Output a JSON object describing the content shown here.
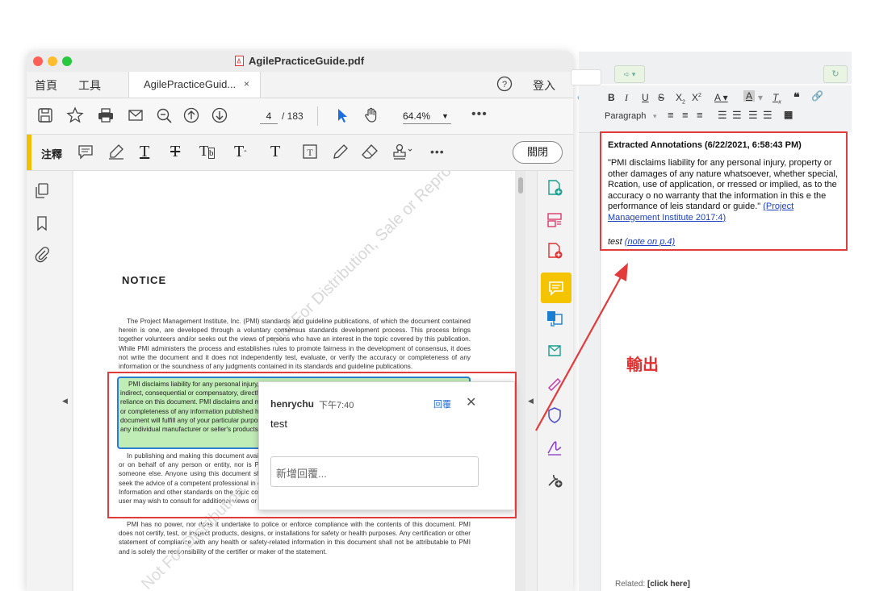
{
  "window": {
    "title": "AgilePracticeGuide.pdf",
    "traffic_lights": {
      "close": "#ff5f57",
      "minimize": "#febc2e",
      "zoom": "#28c840"
    }
  },
  "tabs": {
    "home": "首頁",
    "tools": "工具",
    "document": "AgilePracticeGuid...",
    "close_symbol": "×",
    "signin": "登入",
    "help_icon": "help-icon"
  },
  "toolbar": {
    "page_current": "4",
    "page_total": "/ 183",
    "zoom": "64.4%",
    "icons": [
      "save-icon",
      "bookmark-star-icon",
      "print-icon",
      "mail-icon",
      "zoom-out-icon",
      "page-up-icon",
      "page-down-icon",
      "select-cursor-icon",
      "hand-icon",
      "more-icon"
    ]
  },
  "annotation_toolbar": {
    "label": "注釋",
    "close_label": "關閉",
    "accent": "#f0c000",
    "icons": [
      "sticky-note-icon",
      "highlight-icon",
      "underline-icon",
      "strikethrough-icon",
      "replace-text-icon",
      "insert-text-icon",
      "text-icon",
      "textbox-icon",
      "pencil-icon",
      "eraser-icon",
      "stamp-icon",
      "more-icon"
    ]
  },
  "document": {
    "heading": "NOTICE",
    "paragraphs": [
      "The Project Management Institute, Inc. (PMI) standards and guideline publications, of which the document contained herein is one, are developed through a voluntary consensus standards development process. This process brings together volunteers and/or seeks out the views of persons who have an interest in the topic covered by this publication. While PMI administers the process and establishes rules to promote fairness in the development of consensus, it does not write the document and it does not independently test, evaluate, or verify the accuracy or completeness of any information or the soundness of any judgments contained in its standards and guideline publications.",
      "In publishing and making this document available, PMI is not undertaking to render professional or other services for or on behalf of any person or entity, nor is PMI undertaking to perform any duty owed by any person or entity to someone else. Anyone using this document should rely on his or her own independent judgment or, as appropriate, seek the advice of a competent professional in determining the exercise of reasonable care in any given circumstances. Information and other standards on the topic covered by this publication may be available from other sources, which the user may wish to consult for additional views or information not covered by this publication.",
      "PMI has no power, nor does it undertake to police or enforce compliance with the contents of this document. PMI does not certify, test, or inspect products, designs, or installations for safety or health purposes. Any certification or other statement of compliance with any health or safety-related information in this document shall not be attributable to PMI and is solely the responsibility of the certifier or maker of the statement."
    ],
    "highlighted": "PMI disclaims liability for any personal injury, property or other damages of any nature whatsoever, whether special, indirect, consequential or compensatory, directly or indirectly resulting from the publication, use of application, or reliance on this document. PMI disclaims and makes no guaranty or warranty, expressed or implied, as to the accuracy or completeness of any information published herein, and disclaims and makes no warranty that the information in this document will fulfill any of your particular purposes or needs. PMI does not undertake to guarantee the performance of any individual manufacturer or seller's products or services by virtue of this standard or guide.",
    "watermark": "Not For Distribution, Sale or Reproduction.",
    "watermark2": "Not For Distribution"
  },
  "comment": {
    "user": "henrychu",
    "time": "下午7:40",
    "reply": "回覆",
    "close": "✕",
    "body": "test",
    "reply_placeholder": "新增回覆..."
  },
  "editor": {
    "toolbar_icons": [
      "bold-icon",
      "italic-icon",
      "underline-icon",
      "strike-icon",
      "subscript-icon",
      "superscript-icon",
      "font-color-icon",
      "bg-color-icon",
      "clear-format-icon",
      "quote-icon",
      "link-icon"
    ],
    "paragraph_select": "Paragraph",
    "annotations_heading": "Extracted Annotations (6/22/2021, 6:58:43 PM)",
    "quote": "\"PMI disclaims liability for any personal injury, property or other damages of any nature whatsoever, whether special, Rcation, use of application, or rressed or implied, as to the accuracy o no warranty that the information in this e the performance of leis standard or guide.\" ",
    "citation": "(Project Management Institute 2017:4)",
    "note_text": "test ",
    "note_link": "(note on p.4)",
    "related_label": "Related:",
    "related_link": "[click here]"
  },
  "callout": {
    "label": "輸出",
    "color": "#e03030"
  }
}
